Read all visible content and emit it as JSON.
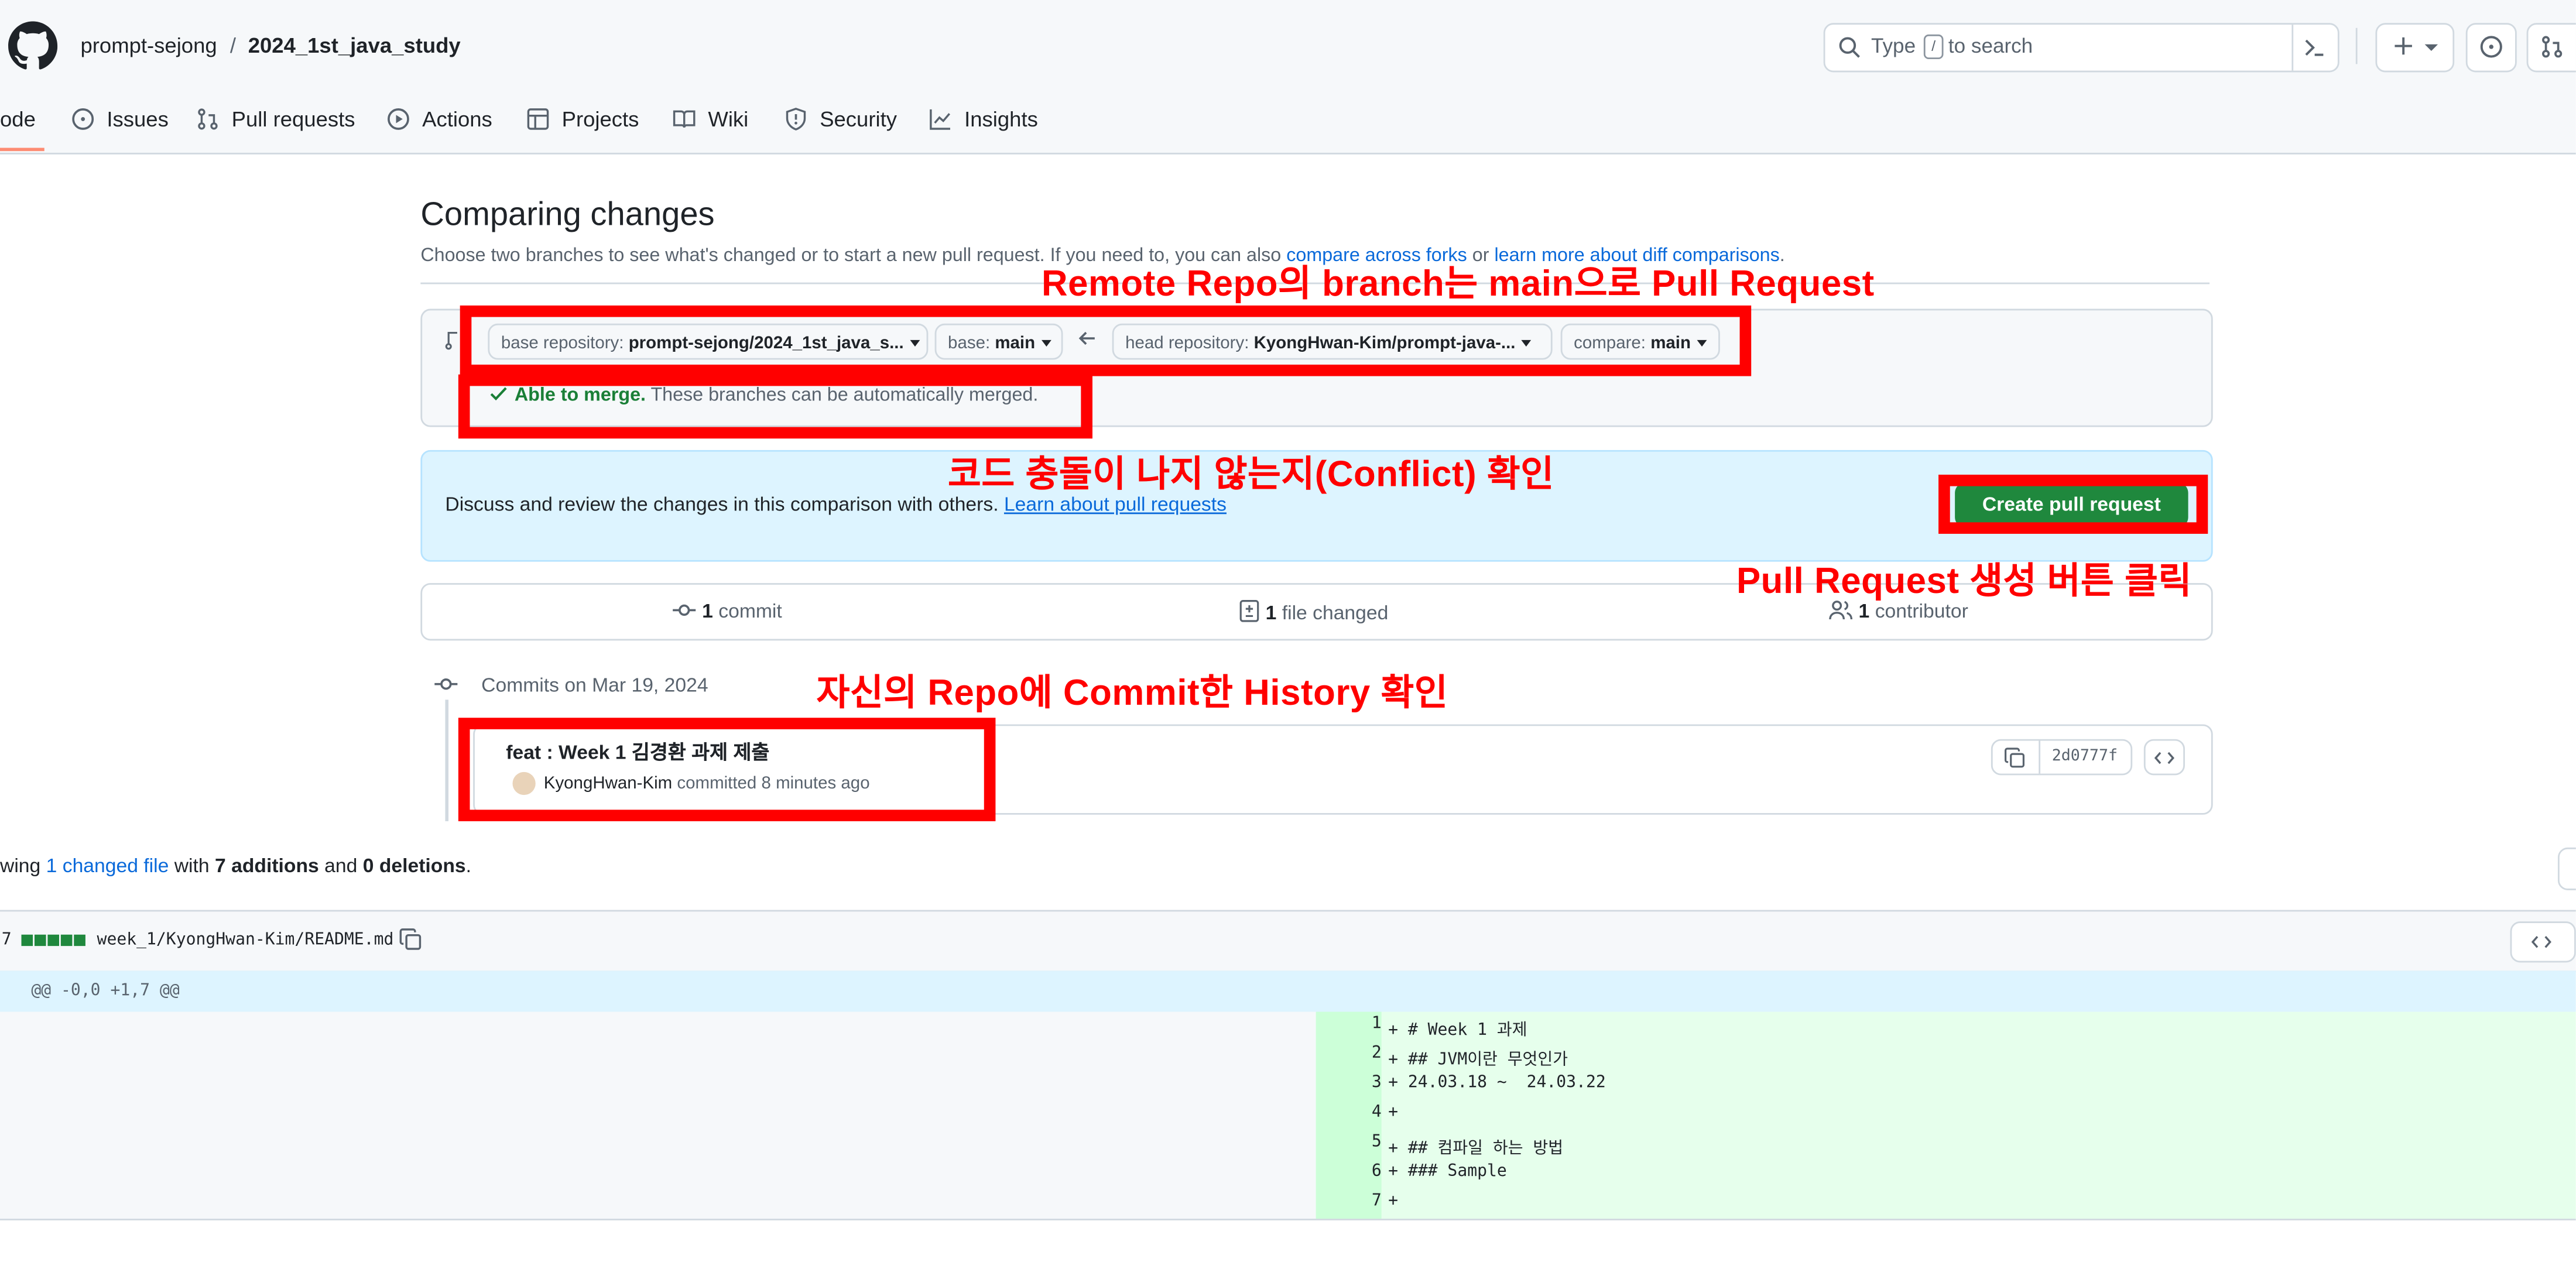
{
  "header": {
    "owner": "prompt-sejong",
    "separator": "/",
    "repo": "2024_1st_java_study",
    "search_prefix": "Type",
    "search_key": "/",
    "search_suffix": "to search"
  },
  "nav": {
    "code": "ode",
    "issues": "Issues",
    "pull_requests": "Pull requests",
    "actions": "Actions",
    "projects": "Projects",
    "wiki": "Wiki",
    "security": "Security",
    "insights": "Insights"
  },
  "compare": {
    "title": "Comparing changes",
    "subtitle": "Choose two branches to see what's changed or to start a new pull request. If you need to, you can also",
    "link1": "compare across forks",
    "or": "or",
    "link2": "learn more about diff comparisons",
    "period": ".",
    "base_repo_label": "base repository:",
    "base_repo_value": "prompt-sejong/2024_1st_java_s...",
    "base_label": "base:",
    "base_value": "main",
    "head_repo_label": "head repository:",
    "head_repo_value": "KyongHwan-Kim/prompt-java-...",
    "compare_label": "compare:",
    "compare_value": "main",
    "merge_title": "Able to merge.",
    "merge_text": "These branches can be automatically merged."
  },
  "pr_banner": {
    "text": "Discuss and review the changes in this comparison with others.",
    "link": "Learn about pull requests",
    "button": "Create pull request"
  },
  "stats": {
    "commits_num": "1",
    "commits_label": "commit",
    "files_num": "1",
    "files_label": "file changed",
    "contrib_num": "1",
    "contrib_label": "contributor"
  },
  "commits": {
    "date_header": "Commits on Mar 19, 2024",
    "message": "feat : Week 1 김경환 과제 제출",
    "author": "KyongHwan-Kim",
    "committed": "committed 8 minutes ago",
    "sha": "2d0777f"
  },
  "diff_summary": {
    "prefix": "wing",
    "changed": "1 changed file",
    "with": "with",
    "additions": "7 additions",
    "and": "and",
    "deletions": "0 deletions",
    "period": "."
  },
  "file": {
    "count": "7",
    "path": "week_1/KyongHwan-Kim/README.md",
    "hunk": "@@ -0,0 +1,7 @@",
    "lines": [
      {
        "n": "1",
        "code": "+ # Week 1 과제"
      },
      {
        "n": "2",
        "code": "+ ## JVM이란 무엇인가"
      },
      {
        "n": "3",
        "code": "+ 24.03.18 ~  24.03.22"
      },
      {
        "n": "4",
        "code": "+"
      },
      {
        "n": "5",
        "code": "+ ## 컴파일 하는 방법"
      },
      {
        "n": "6",
        "code": "+ ### Sample"
      },
      {
        "n": "7",
        "code": "+"
      }
    ]
  },
  "annotations": {
    "branch": "Remote Repo의 branch는 main으로 Pull Request",
    "conflict": "코드 충돌이 나지 않는지(Conflict) 확인",
    "create": "Pull Request 생성 버튼 클릭",
    "history": "자신의 Repo에 Commit한 History 확인"
  },
  "colors": {
    "annotation_red": "#ff0000",
    "create_button_green": "#1f883d",
    "link_blue": "#0969da",
    "added_line_bg": "#e6ffec",
    "hunk_bg": "#ddf4ff",
    "merge_green": "#1a7f37"
  }
}
